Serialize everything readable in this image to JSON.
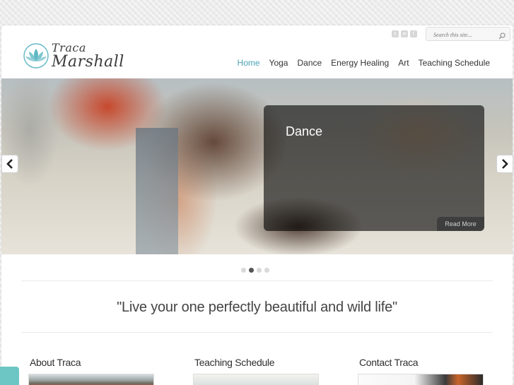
{
  "header": {
    "search_placeholder": "Search this site...",
    "social_icons": [
      "twitter-icon",
      "rss-icon",
      "facebook-icon"
    ],
    "logo": {
      "line1": "Traca",
      "line2": "Marshall"
    }
  },
  "nav": [
    {
      "label": "Home",
      "active": true
    },
    {
      "label": "Yoga",
      "active": false
    },
    {
      "label": "Dance",
      "active": false
    },
    {
      "label": "Energy Healing",
      "active": false
    },
    {
      "label": "Art",
      "active": false
    },
    {
      "label": "Teaching Schedule",
      "active": false
    }
  ],
  "slider": {
    "caption_title": "Dance",
    "read_more": "Read More",
    "slide_count": 4,
    "active_slide": 2
  },
  "quote": "\"Live your one perfectly beautiful and wild life\"",
  "columns": [
    {
      "title": "About Traca"
    },
    {
      "title": "Teaching Schedule"
    },
    {
      "title": "Contact Traca"
    }
  ],
  "colors": {
    "accent": "#4aa3b4",
    "nav_text": "#333333",
    "feedback_tab": "#6ec6c4"
  }
}
